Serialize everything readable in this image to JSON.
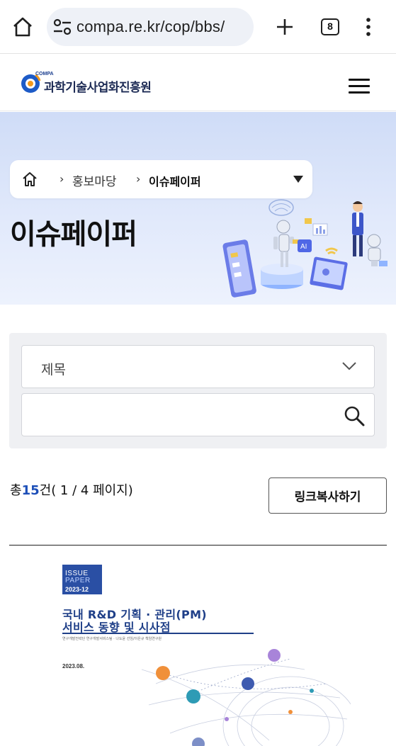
{
  "browser": {
    "url": "compa.re.kr/cop/bbs/",
    "tab_count": "8"
  },
  "site": {
    "logo_sup": "COMPA",
    "logo_name": "과학기술사업화진흥원"
  },
  "breadcrumb": {
    "items": [
      "홍보마당",
      "이슈페이퍼"
    ],
    "separator": "›"
  },
  "hero": {
    "title": "이슈페이퍼",
    "illustration_badge": "AI"
  },
  "search": {
    "select_value": "제목",
    "input_value": "",
    "input_placeholder": ""
  },
  "listing": {
    "count_prefix": "총",
    "count": "15",
    "count_suffix": "건",
    "page_info": "( 1 / 4 페이지)",
    "copy_link_label": "링크복사하기"
  },
  "report": {
    "badge_line1": "ISSUE",
    "badge_line2": "PAPER",
    "badge_issue": "2023-12",
    "title_line1": "국내 R&D 기획 · 관리(PM)",
    "title_line2": "서비스 동향 및 시사점",
    "subtitle": "연구개발전략단 연구개발서비스팀 · 나도윤 선임/이은규 책임연구원",
    "date": "2023.08."
  },
  "colors": {
    "accent": "#1d4fb8",
    "hero_bg": "#dce6fa",
    "search_bg": "#eff0f3",
    "report_blue": "#1f3f88"
  }
}
